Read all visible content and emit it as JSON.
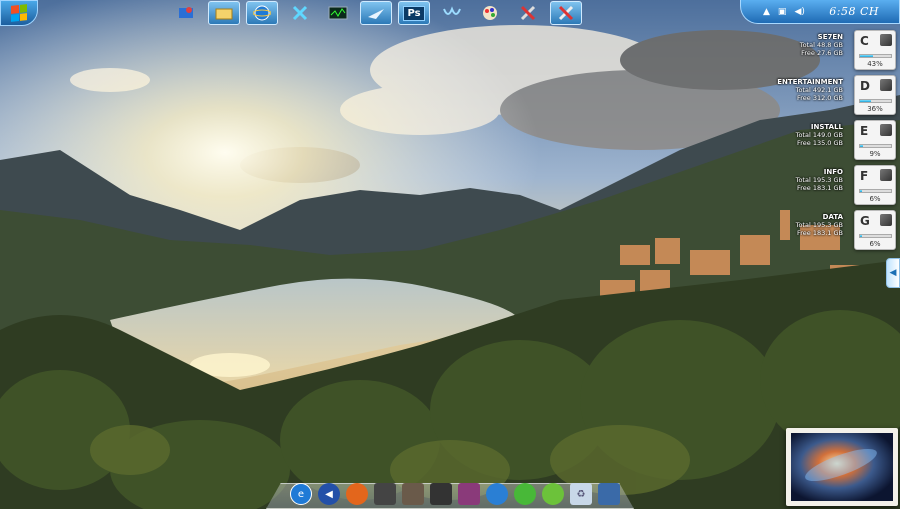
{
  "taskbar": {
    "clock": "6:58 CH",
    "quick_icons": [
      {
        "name": "user-icon"
      },
      {
        "name": "explorer-folder-icon"
      },
      {
        "name": "internet-explorer-icon"
      },
      {
        "name": "xion-icon"
      },
      {
        "name": "task-manager-icon"
      },
      {
        "name": "app-icon"
      },
      {
        "name": "photoshop-icon",
        "label": "Ps"
      },
      {
        "name": "winamp-icon"
      },
      {
        "name": "paint-icon"
      },
      {
        "name": "tools-icon"
      },
      {
        "name": "tools-icon-2"
      }
    ]
  },
  "drives": [
    {
      "name": "SE7EN",
      "total": "Total 48.8 GB",
      "free": "Free 27.6 GB",
      "letter": "C",
      "percent": "43%",
      "used": 43
    },
    {
      "name": "ENTERTAINMENT",
      "total": "Total 492.1 GB",
      "free": "Free 312.0 GB",
      "letter": "D",
      "percent": "36%",
      "used": 36
    },
    {
      "name": "INSTALL",
      "total": "Total 149.0 GB",
      "free": "Free 135.0 GB",
      "letter": "E",
      "percent": "9%",
      "used": 9
    },
    {
      "name": "INFO",
      "total": "Total 195.3 GB",
      "free": "Free 183.1 GB",
      "letter": "F",
      "percent": "6%",
      "used": 6
    },
    {
      "name": "DATA",
      "total": "Total 195.3 GB",
      "free": "Free 183.1 GB",
      "letter": "G",
      "percent": "6%",
      "used": 6
    }
  ],
  "dock_icons": [
    "ie-dock-icon",
    "speaker-dock-icon",
    "firefox-dock-icon",
    "app-dock-icon",
    "tools-dock-icon",
    "app-dock-icon-2",
    "app-dock-icon-3",
    "browser-dock-icon",
    "frog-dock-icon",
    "chameleon-dock-icon",
    "recycle-bin-icon",
    "monitor-dock-icon"
  ],
  "colors": {
    "taskbar": "#1f6bb4",
    "accent": "#5aaef0"
  }
}
